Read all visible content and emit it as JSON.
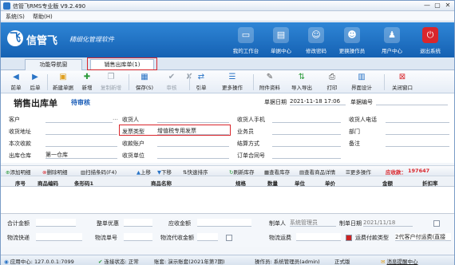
{
  "window": {
    "title": "信管飞RMS专业版 V9.2.490",
    "min": "—",
    "max": "▢",
    "close": "✕"
  },
  "menu": [
    "系统(S)",
    "帮助(H)"
  ],
  "banner": {
    "logo": "飞",
    "brand": "信管飞",
    "slogan": "精细化管理软件"
  },
  "topnav": [
    {
      "label": "我的工作台",
      "icon": "desktop-icon"
    },
    {
      "label": "单据中心",
      "icon": "documents-icon"
    },
    {
      "label": "修改密码",
      "icon": "user-key-icon"
    },
    {
      "label": "更换操作员",
      "icon": "switch-user-icon"
    },
    {
      "label": "用户中心",
      "icon": "user-center-icon"
    },
    {
      "label": "退出系统",
      "icon": "power-icon"
    }
  ],
  "tabs": [
    "功能导航窗",
    "销售出库单(1)"
  ],
  "toolbar": {
    "prev": "前单",
    "next": "后单",
    "new": "新建单据",
    "add": "新增",
    "copy": "复制新增",
    "save": "保存(S)",
    "audit": "审核",
    "unaudit": "审核",
    "reference": "引单",
    "more": "更多操作",
    "attach": "附件资料",
    "import": "导入导出",
    "print": "打印",
    "ui": "界面设计",
    "close": "关闭窗口"
  },
  "header": {
    "title": "销售出库单",
    "status": "待审核",
    "date_label": "单据日期",
    "date_value": "2021-11-18 17:06",
    "no_label": "单据编号",
    "no_value": ""
  },
  "form": {
    "customer": "客户",
    "receiver": "收货人",
    "receiver_phone": "收货人手机",
    "receiver_tel": "收货人电话",
    "address": "收货地址",
    "invoice_type": "发票类型",
    "invoice_value": "增值税专用发票",
    "salesman": "业务员",
    "dept": "部门",
    "this_receipt": "本次收款",
    "receipt_account": "收款账户",
    "settle": "结算方式",
    "remark": "备注",
    "warehouse": "出库仓库",
    "warehouse_value": "第一仓库",
    "receiver_unit": "收货单位",
    "contract": "订单合同号"
  },
  "gridbar": {
    "add": "添加明细",
    "del": "删除明细",
    "scan": "扫描条码(F4)",
    "up": "上移",
    "down": "下移",
    "quicksort": "快速排序",
    "refresh": "刷新库存",
    "savewh": "查看库存",
    "goods": "查看商品详情",
    "more": "更多操作",
    "receivable_label": "应收款：",
    "receivable_value": "197647"
  },
  "grid": {
    "columns": [
      "序号",
      "商品编码",
      "条形码1",
      "商品名称",
      "规格",
      "数量",
      "单位",
      "单价",
      "金额",
      "折扣率"
    ]
  },
  "footer": {
    "total": "合计金额",
    "whole_discount": "整单优惠",
    "receivable": "应收金额",
    "maker": "制单人",
    "maker_value": "系统管理员",
    "make_date": "制单日期",
    "make_date_value": "2021/11/18",
    "express": "物流快递",
    "express_no": "物流单号",
    "express_cod": "物流代收金额",
    "express_fee": "物流运费",
    "fee_pay": "运费付款类型",
    "fee_pay_value": "2代客户付运费(直接"
  },
  "status": {
    "app": "应用中心: 127.0.0.1:7099",
    "conn": "连接状态: 正常",
    "account": "账套: 演示账套(2021年第7期)",
    "operator": "操作员: 系统管理员(admin)",
    "version": "正式版",
    "msg": "消息提醒中心"
  }
}
